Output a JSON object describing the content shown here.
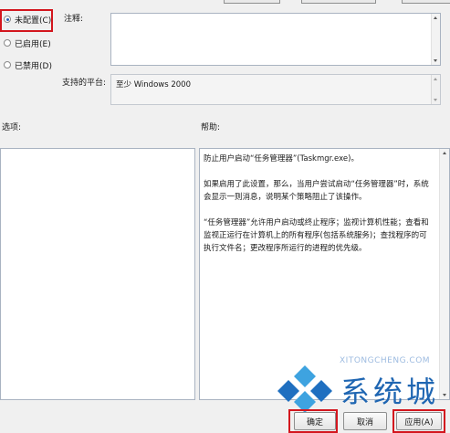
{
  "state_options": [
    {
      "label": "未配置(C)",
      "checked": true
    },
    {
      "label": "已启用(E)",
      "checked": false
    },
    {
      "label": "已禁用(D)",
      "checked": false
    }
  ],
  "comment_label": "注释:",
  "supported_platform_label": "支持的平台:",
  "supported_platform_value": "至少 Windows 2000",
  "options_label": "选项:",
  "help_label": "帮助:",
  "help_paragraphs": [
    "防止用户启动“任务管理器”(Taskmgr.exe)。",
    "如果启用了此设置，那么，当用户尝试启动“任务管理器”时，系统会显示一则消息，说明某个策略阻止了该操作。",
    "“任务管理器”允许用户启动或终止程序；监视计算机性能；查看和监视正运行在计算机上的所有程序(包括系统服务)；查找程序的可执行文件名；更改程序所运行的进程的优先级。"
  ],
  "buttons": {
    "ok": "确定",
    "cancel": "取消",
    "apply": "应用(A)"
  },
  "watermark": {
    "url": "XITONGCHENG.COM",
    "text": "系统城"
  },
  "colors": {
    "highlight_red": "#d3161e",
    "watermark_blue": "#1f66b2"
  }
}
